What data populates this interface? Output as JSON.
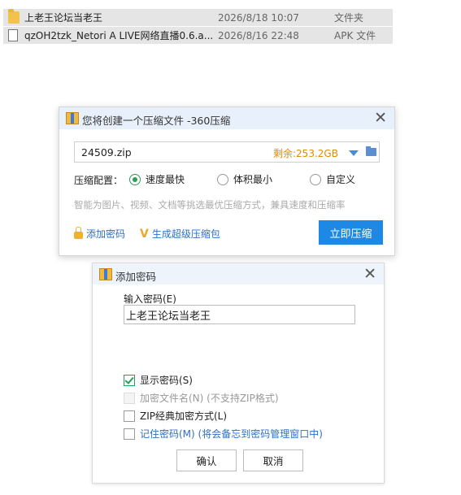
{
  "files": [
    {
      "name": "上老王论坛当老王",
      "date": "2026/8/18 10:07",
      "type": "文件夹",
      "icon": "folder-icon"
    },
    {
      "name": "qzOH2tzk_Netori A LIVE网络直播0.6.a...",
      "date": "2026/8/16 22:48",
      "type": "APK 文件",
      "icon": "file-icon"
    }
  ],
  "compress_dialog": {
    "title": "您将创建一个压缩文件 -360压缩",
    "filename": "24509.zip",
    "free_space": "剩余:253.2GB",
    "config_label": "压缩配置：",
    "options": [
      "速度最快",
      "体积最小",
      "自定义"
    ],
    "selected_option": "速度最快",
    "hint": "智能为图片、视频、文档等挑选最优压缩方式，兼具速度和压缩率",
    "add_password_link": "添加密码",
    "super_compress_link": "生成超级压缩包",
    "compress_button": "立即压缩"
  },
  "password_dialog": {
    "title": "添加密码",
    "input_label": "输入密码(E)",
    "password_value": "上老王论坛当老王",
    "show_password": "显示密码(S)",
    "encrypt_filenames": "加密文件名(N) (不支持ZIP格式)",
    "zip_classic": "ZIP经典加密方式(L)",
    "remember_password": "记住密码(M) (将会备忘到密码管理窗口中)",
    "ok_button": "确认",
    "cancel_button": "取消"
  },
  "colors": {
    "accent": "#1e88e5",
    "free_space": "#e58a00",
    "check_green": "#2a9d57",
    "link_blue": "#2f6fc4"
  }
}
